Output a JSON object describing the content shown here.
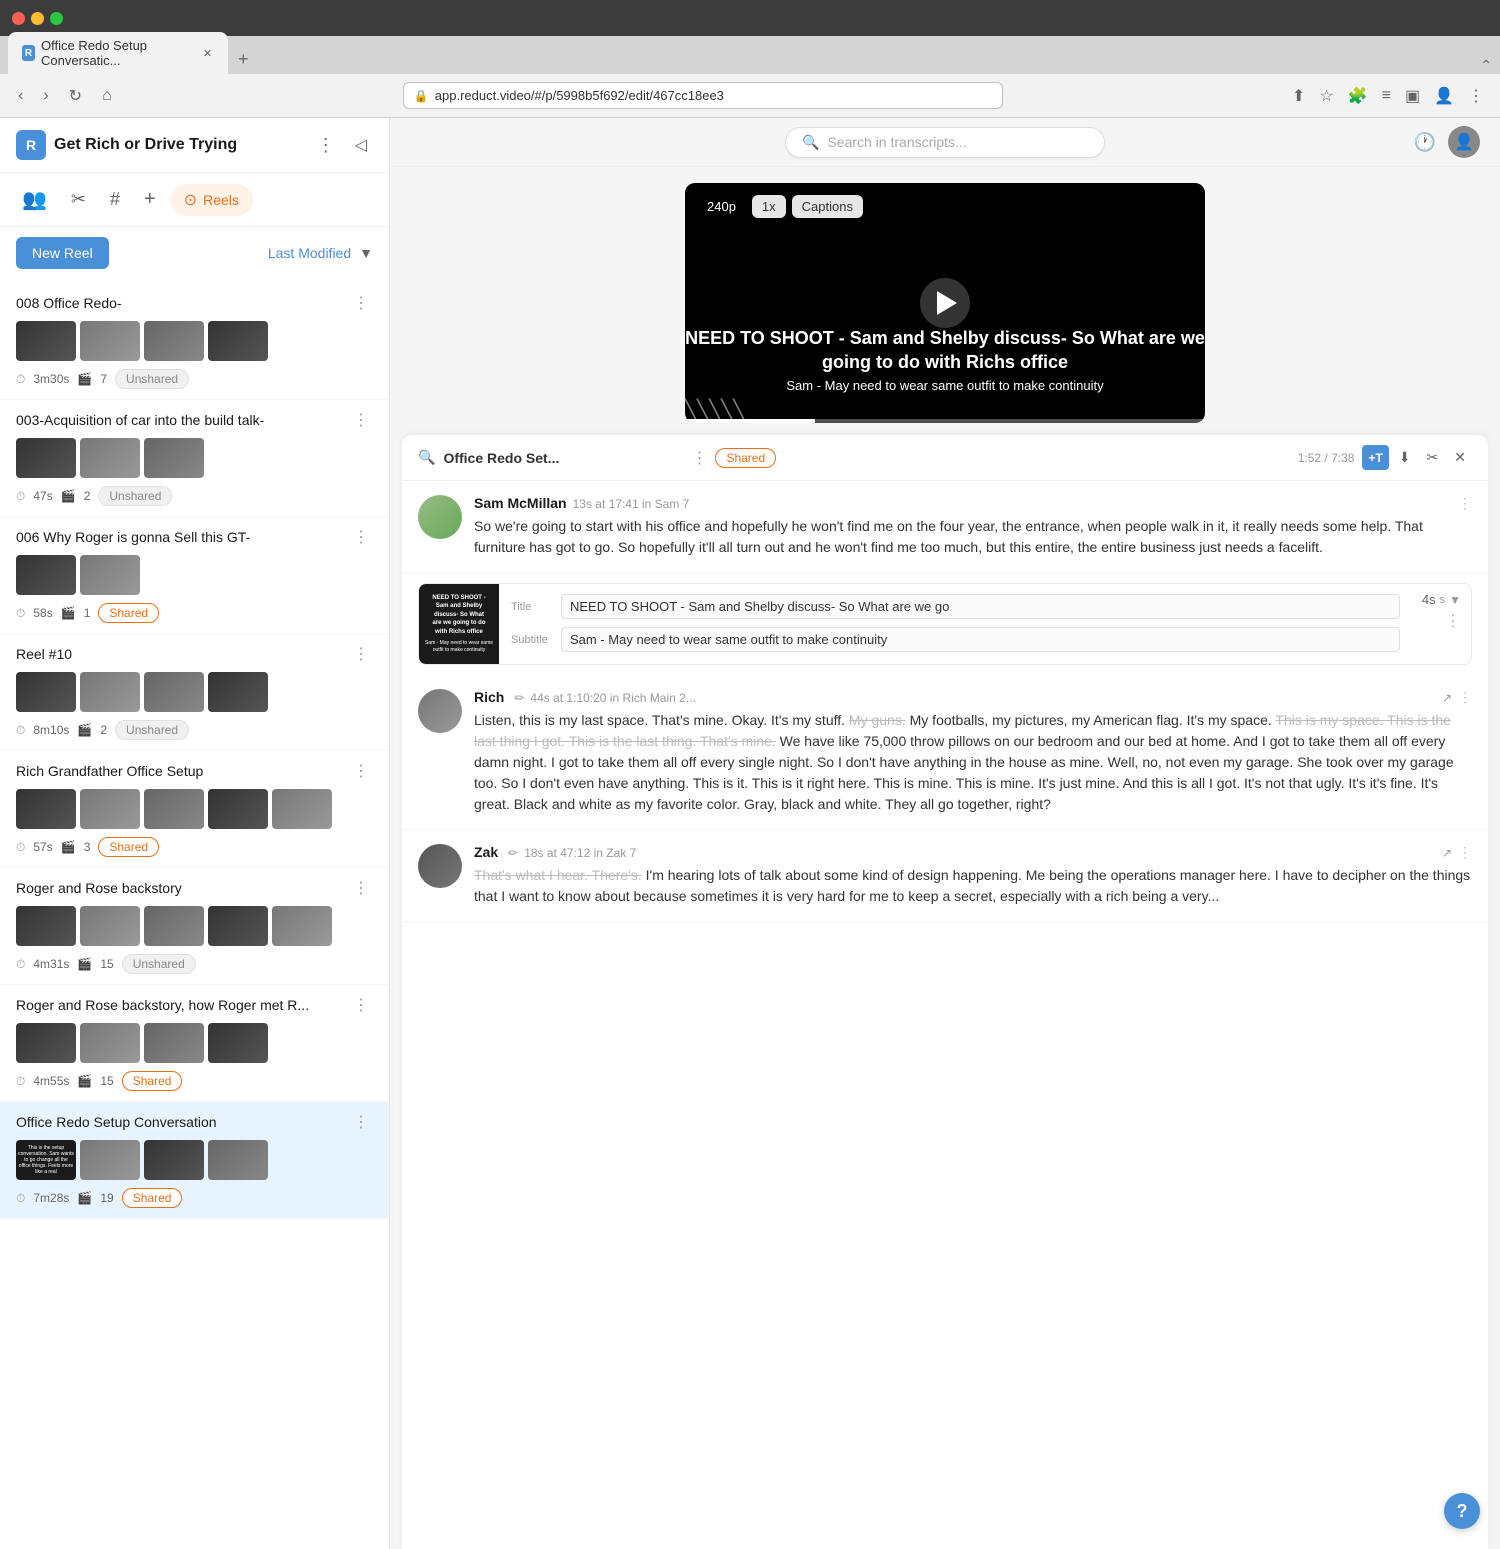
{
  "browser": {
    "tab_title": "Office Redo Setup Conversatic...",
    "address": "app.reduct.video/#/p/5998b5f692/edit/467cc18ee3",
    "tab_plus": "+",
    "nav": {
      "back": "‹",
      "forward": "›",
      "refresh": "↻",
      "home": "⌂"
    }
  },
  "sidebar": {
    "logo_letter": "R",
    "project_title": "Get Rich or Drive Trying",
    "tabs": [
      {
        "id": "people",
        "icon": "👥",
        "active": false
      },
      {
        "id": "scissors",
        "icon": "✂",
        "active": false
      },
      {
        "id": "hash",
        "icon": "#",
        "active": false
      },
      {
        "id": "plus",
        "icon": "+",
        "active": false
      },
      {
        "id": "reels",
        "label": "Reels",
        "active": true
      }
    ],
    "toolbar": {
      "new_reel_label": "New Reel",
      "last_modified_label": "Last Modified",
      "sort_icon": "▼"
    },
    "reels": [
      {
        "name": "008 Office Redo-",
        "duration": "3m30s",
        "clips": "7",
        "shared": false,
        "badge_label": "Unshared",
        "thumb_count": 4
      },
      {
        "name": "003-Acquisition of car into the build talk-",
        "duration": "47s",
        "clips": "2",
        "shared": false,
        "badge_label": "Unshared",
        "thumb_count": 3
      },
      {
        "name": "006 Why Roger is gonna Sell this GT-",
        "duration": "58s",
        "clips": "1",
        "shared": true,
        "badge_label": "Shared",
        "thumb_count": 2
      },
      {
        "name": "Reel #10",
        "duration": "8m10s",
        "clips": "2",
        "shared": false,
        "badge_label": "Unshared",
        "thumb_count": 4
      },
      {
        "name": "Rich Grandfather Office Setup",
        "duration": "57s",
        "clips": "3",
        "shared": true,
        "badge_label": "Shared",
        "thumb_count": 5
      },
      {
        "name": "Roger and Rose backstory",
        "duration": "4m31s",
        "clips": "15",
        "shared": false,
        "badge_label": "Unshared",
        "thumb_count": 5
      },
      {
        "name": "Roger and Rose backstory, how Roger met R...",
        "duration": "4m55s",
        "clips": "15",
        "shared": true,
        "badge_label": "Shared",
        "thumb_count": 4
      },
      {
        "name": "Office Redo Setup Conversation",
        "duration": "7m28s",
        "clips": "19",
        "shared": true,
        "badge_label": "Shared",
        "thumb_count": 4,
        "active": true
      }
    ]
  },
  "header": {
    "search_placeholder": "Search in transcripts...",
    "history_icon": "🕐",
    "user_icon": "👤"
  },
  "video": {
    "resolution_badge": "240p",
    "playback_badge": "1x",
    "captions_badge": "Captions",
    "title_text": "NEED TO SHOOT - Sam and Shelby discuss- So What are we going to do with Richs office",
    "subtitle_text": "Sam - May need to wear same outfit to make continuity",
    "progress_width": "25%"
  },
  "transcript": {
    "title": "Office Redo Set...",
    "shared_label": "Shared",
    "timestamp": "1:52 / 7:38",
    "t1_label": "+T",
    "download_icon": "⬇",
    "scissors_icon": "✂",
    "close_icon": "✕",
    "messages": [
      {
        "id": "sam",
        "speaker": "Sam McMillan",
        "meta": "13s at 17:41 in Sam 7",
        "text": "So we're going to start with his office and hopefully he won't find me on the four year, the entrance, when people walk in it, it really needs some help. That furniture has got to go. So hopefully it'll all turn out and he won't find me too much, but this entire, the entire business just needs a facelift.",
        "strikethrough": false
      },
      {
        "id": "title-card",
        "type": "title",
        "thumb_title": "NEED TO SHOOT - Sam and Shelby discuss- So What are we going to do with Richs office",
        "thumb_subtitle": "Sam - May need to wear same outfit to make continuity",
        "title_field_label": "Title",
        "title_value": "NEED TO SHOOT - Sam and Shelby discuss- So What are we go",
        "subtitle_field_label": "Subtitle",
        "subtitle_value": "Sam - May need to wear same outfit to make continuity",
        "duration": "4s"
      },
      {
        "id": "rich",
        "speaker": "Rich",
        "meta": "44s at 1:10:20 in Rich Main 2...",
        "text_normal": "Listen, this is my last space. That's mine. Okay. It's my stuff.",
        "text_strike1": "My guns.",
        "text_normal2": "My footballs, my pictures, my American flag. It's my space.",
        "text_strike2": "This is my space. This is the last thing I got. This is the last thing. That's mine.",
        "text_normal3": "We have like 75,000 throw pillows on our bedroom and our bed at home. And I got to take them all off every damn night. I got to take them all off every single night. So I don't have anything in the house as mine. Well, no, not even my garage. She took over my garage too. So I don't even have anything. This is it. This is it right here. This is mine. This is mine. It's just mine. And this is all I got. It's not that ugly. It's it's fine. It's great. Black and white as my favorite color. Gray, black and white. They all go together, right?"
      },
      {
        "id": "zak",
        "speaker": "Zak",
        "meta": "18s at 47:12 in Zak 7",
        "text_strike": "That's what I hear. There's.",
        "text_normal": "I'm hearing lots of talk about some kind of design happening. Me being the operations manager here. I have to decipher on the things that I want to know about because sometimes it is very hard for me to keep a secret, especially with a rich being a very..."
      }
    ]
  }
}
